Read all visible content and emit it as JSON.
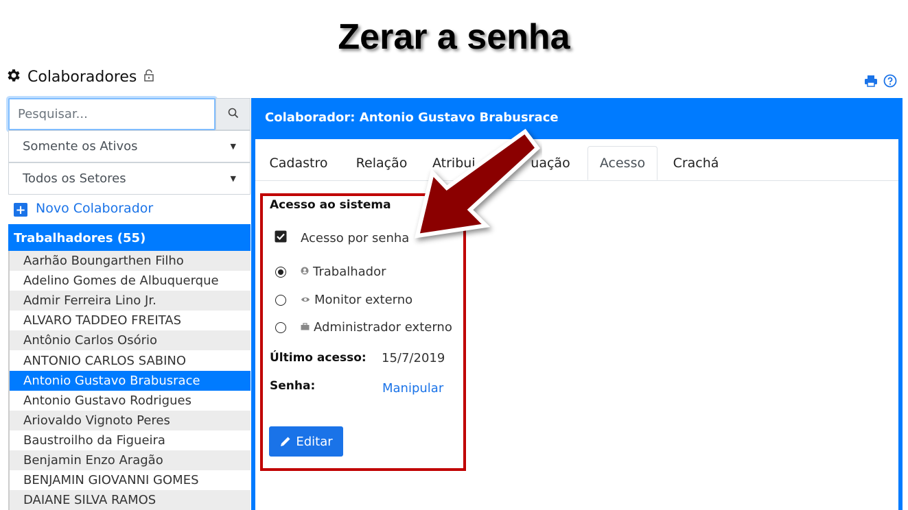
{
  "slide_title": "Zerar a senha",
  "header": {
    "title": "Colaboradores"
  },
  "search": {
    "placeholder": "Pesquisar..."
  },
  "filters": {
    "status": "Somente os Ativos",
    "sector": "Todos os Setores"
  },
  "new_button": "Novo Colaborador",
  "list": {
    "header": "Trabalhadores (55)",
    "items": [
      "Aarhão Boungarthen Filho",
      "Adelino Gomes de Albuquerque",
      "Admir Ferreira Lino Jr.",
      "ALVARO TADDEO FREITAS",
      "Antônio Carlos Osório",
      "ANTONIO CARLOS SABINO",
      "Antonio Gustavo Brabusrace",
      "Antonio Gustavo Rodrigues",
      "Ariovaldo Vignoto Peres",
      "Baustroilho da Figueira",
      "Benjamin Enzo Aragão",
      "BENJAMIN GIOVANNI GOMES",
      "DAIANE SILVA RAMOS"
    ],
    "selected_index": 6
  },
  "card": {
    "title": "Colaborador: Antonio Gustavo Brabusrace",
    "tabs": [
      "Cadastro",
      "Relação",
      "Atribui",
      "uação",
      "Acesso",
      "Crachá"
    ],
    "active_tab": "Acesso"
  },
  "acesso": {
    "section_title": "Acesso ao sistema",
    "checkbox_label": "Acesso por senha",
    "checkbox_checked": true,
    "radios": [
      "Trabalhador",
      "Monitor externo",
      "Administrador externo"
    ],
    "radio_selected": "Trabalhador",
    "last_access_label": "Último acesso:",
    "last_access_value": "15/7/2019",
    "password_label": "Senha:",
    "password_link": "Manipular",
    "edit_button": "Editar"
  },
  "colors": {
    "primary": "#007bff",
    "highlight_box": "#c00000",
    "arrow": "#a00000"
  },
  "icons": [
    "gear-icon",
    "lock-icon",
    "search-icon",
    "plus-icon",
    "printer-icon",
    "help-icon",
    "pencil-icon",
    "user-icon",
    "eye-icon",
    "briefcase-icon",
    "check-icon"
  ]
}
